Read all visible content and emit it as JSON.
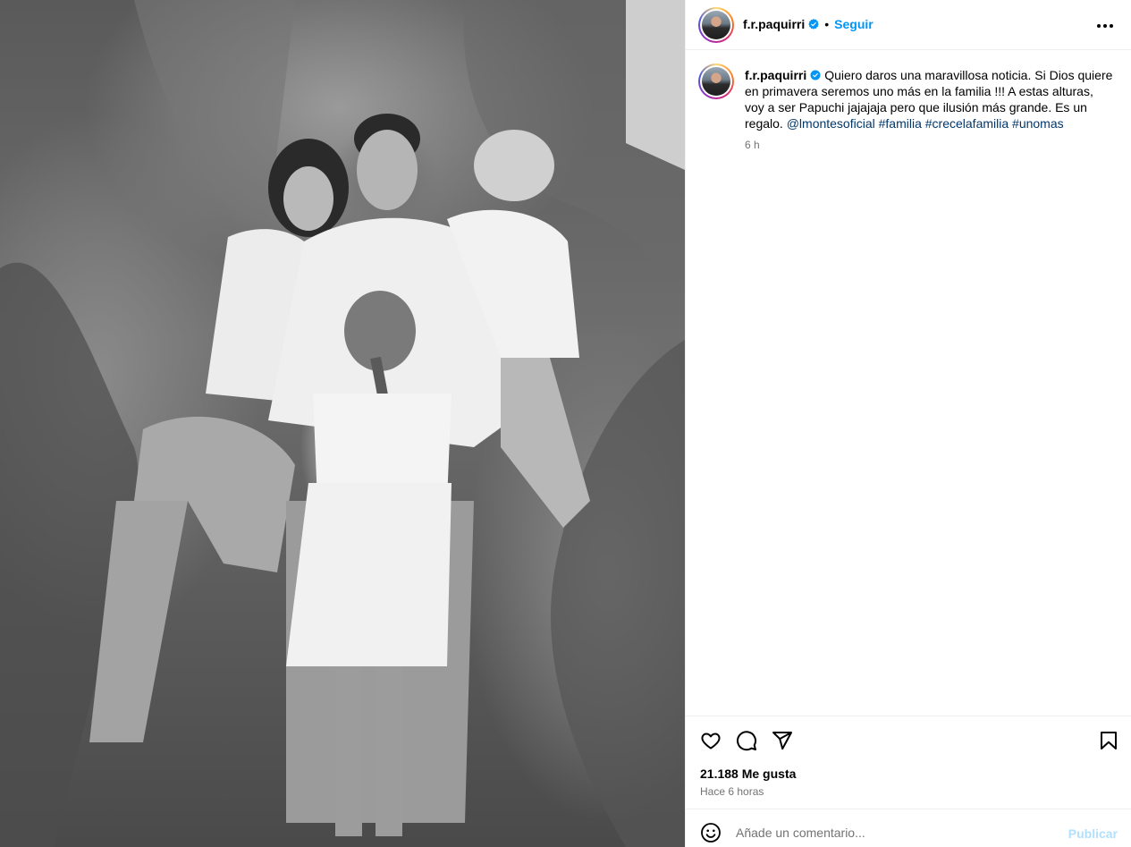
{
  "post": {
    "username": "f.r.paquirri",
    "follow_label": "Seguir",
    "dot": "•",
    "caption_prefix": "Quiero daros una maravillosa noticia. Si Dios quiere en primavera seremos uno más en la familia !!! A estas alturas, voy a ser Papuchi jajajaja pero que ilusión más grande. Es un regalo.",
    "mention": "@lmontesoficial",
    "hashtags": [
      "#familia",
      "#crecelafamilia",
      "#unomas"
    ],
    "caption_age": "6 h",
    "likes": "21.188 Me gusta",
    "posted_ago": "Hace 6 horas"
  },
  "comment": {
    "placeholder": "Añade un comentario...",
    "publish_label": "Publicar"
  },
  "colors": {
    "accent": "#0095f6",
    "link": "#00376b",
    "muted": "#737373",
    "verified": "#0095f6"
  },
  "icons": [
    "verified-badge-icon",
    "more-options-icon",
    "heart-icon",
    "comment-icon",
    "share-icon",
    "bookmark-icon",
    "emoji-icon"
  ]
}
